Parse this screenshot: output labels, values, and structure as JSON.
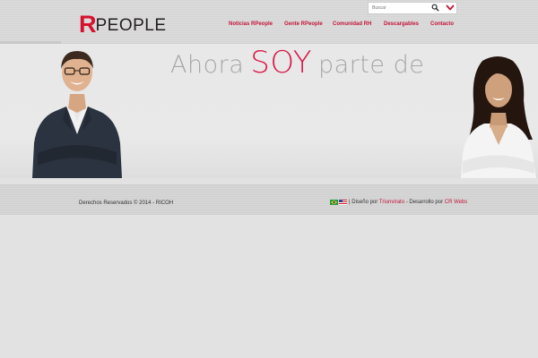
{
  "header": {
    "logo_r": "R",
    "logo_rest": "PEOPLE",
    "search_placeholder": "Buscar",
    "search_icon": "search-icon",
    "toggle_icon": "chevron-down-icon"
  },
  "nav": {
    "items": [
      {
        "label": "Noticias RPeople"
      },
      {
        "label": "Gente RPeople"
      },
      {
        "label": "Comunidad RH"
      },
      {
        "label": "Descargables"
      },
      {
        "label": "Contacto"
      }
    ]
  },
  "hero": {
    "tagline_before": "Ahora",
    "tagline_highlight": "SOY",
    "tagline_after": "parte de"
  },
  "footer": {
    "copyright": "Derechos Reservados © 2014 - RICOH",
    "flags": [
      "brazil-flag-icon",
      "usa-flag-icon"
    ],
    "separator": "|",
    "design_prefix": "Diseño por",
    "design_by": "Triunvirato",
    "dev_prefix": "- Desarrollo por",
    "dev_by": "CR Webs"
  },
  "colors": {
    "brand_red": "#c4163a",
    "logo_red": "#d6122f",
    "tagline_gray": "#a7a7a7",
    "tagline_pink": "#d8194a",
    "background": "#e2e2e2"
  }
}
